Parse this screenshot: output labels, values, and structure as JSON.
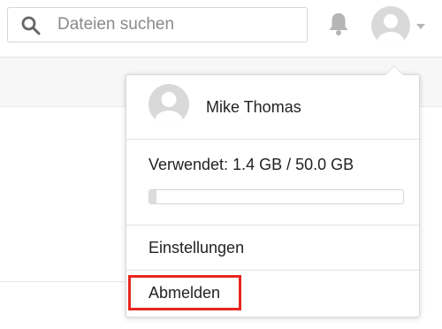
{
  "search": {
    "placeholder": "Dateien suchen",
    "value": ""
  },
  "icons": {
    "search": "search-icon",
    "notifications": "bell-icon",
    "avatar": "user-avatar-icon",
    "menu_caret": "caret-down-icon"
  },
  "user_menu": {
    "user_name": "Mike Thomas",
    "quota_text": "Verwendet: 1.4 GB / 50.0 GB",
    "quota_used_percent": 2.8,
    "settings_label": "Einstellungen",
    "logout_label": "Abmelden"
  },
  "colors": {
    "highlight": "#e8261f",
    "icon_gray": "#b5b5b5"
  }
}
